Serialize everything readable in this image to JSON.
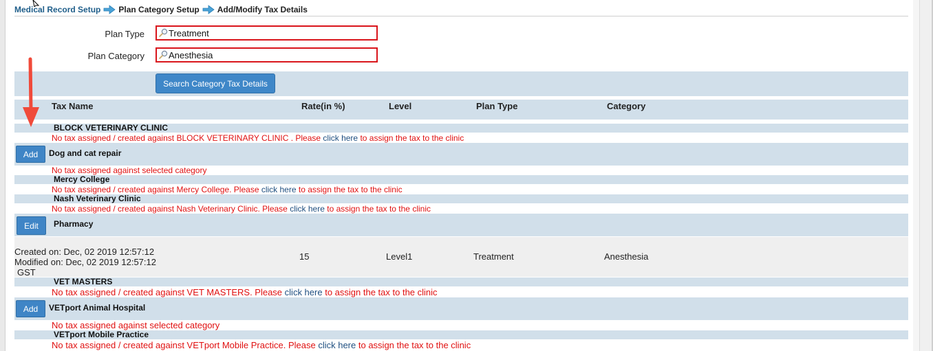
{
  "breadcrumb": {
    "item1": "Medical Record Setup",
    "item2": "Plan Category Setup",
    "item3": "Add/Modify Tax Details"
  },
  "form": {
    "plan_type_label": "Plan Type",
    "plan_type_value": "Treatment",
    "plan_category_label": "Plan Category",
    "plan_category_value": "Anesthesia",
    "search_button": "Search Category Tax Details"
  },
  "table": {
    "headers": {
      "tax_name": "Tax Name",
      "rate": "Rate(in %)",
      "level": "Level",
      "plan_type": "Plan Type",
      "category": "Category"
    }
  },
  "common": {
    "click_here": "click here",
    "assign_suffix": "to assign the tax to the clinic",
    "no_tax_category": "No tax assigned against selected category"
  },
  "rows": {
    "block": {
      "name": "BLOCK VETERINARY CLINIC",
      "msg_prefix": "No tax assigned / created against BLOCK VETERINARY CLINIC . Please"
    },
    "dog": {
      "button": "Add",
      "name": "Dog and cat repair"
    },
    "mercy": {
      "name": "Mercy College",
      "msg_prefix": "No tax assigned / created against Mercy College. Please"
    },
    "nash": {
      "name": "Nash Veterinary Clinic",
      "msg_prefix": "No tax assigned / created against Nash Veterinary Clinic. Please"
    },
    "pharmacy": {
      "button": "Edit",
      "name": "Pharmacy",
      "created": "Created on: Dec, 02 2019 12:57:12",
      "modified": "Modified on: Dec, 02 2019 12:57:12",
      "tax_name": "GST",
      "rate": "15",
      "level": "Level1",
      "plan_type": "Treatment",
      "category": "Anesthesia"
    },
    "vetmasters": {
      "name": "VET MASTERS",
      "msg_prefix": "No tax assigned / created against VET MASTERS. Please"
    },
    "vetport": {
      "button": "Add",
      "name": "VETport Animal Hospital"
    },
    "mobile": {
      "name": "VETport Mobile Practice",
      "msg_prefix": "No tax assigned / created against VETport Mobile Practice. Please"
    }
  },
  "colors": {
    "band": "#d1dfea",
    "button": "#3f87c8",
    "error_text": "#e01010",
    "field_border": "#d9141b",
    "annotation_arrow": "#f04a3a"
  }
}
